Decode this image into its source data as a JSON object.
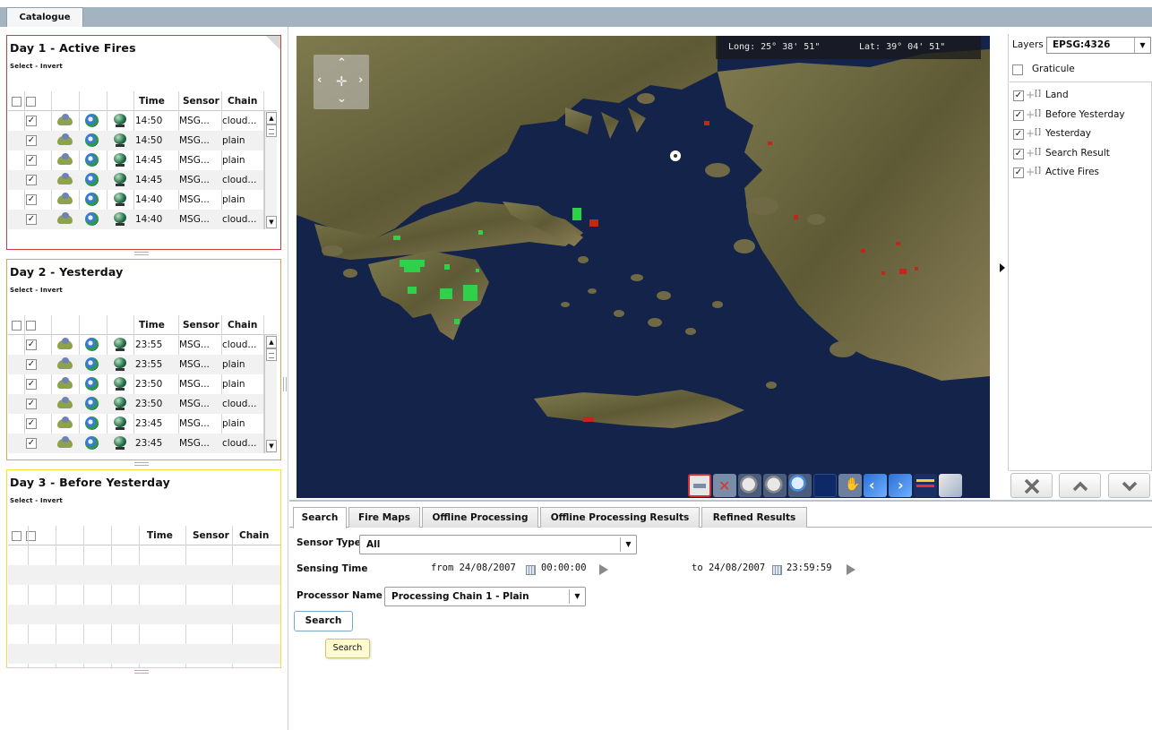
{
  "app": {
    "tab_label": "Catalogue"
  },
  "panels": [
    {
      "title": "Day 1 - Active Fires",
      "select_invert": "Select - Invert",
      "border_color": "#d23a3a",
      "columns": [
        "Time",
        "Sensor",
        "Chain"
      ],
      "rows": [
        {
          "checked": true,
          "time": "14:50",
          "sensor": "MSG...",
          "chain": "cloud..."
        },
        {
          "checked": true,
          "time": "14:50",
          "sensor": "MSG...",
          "chain": "plain"
        },
        {
          "checked": true,
          "time": "14:45",
          "sensor": "MSG...",
          "chain": "plain"
        },
        {
          "checked": true,
          "time": "14:45",
          "sensor": "MSG...",
          "chain": "cloud..."
        },
        {
          "checked": true,
          "time": "14:40",
          "sensor": "MSG...",
          "chain": "plain"
        },
        {
          "checked": true,
          "time": "14:40",
          "sensor": "MSG...",
          "chain": "cloud..."
        }
      ]
    },
    {
      "title": "Day 2 - Yesterday",
      "select_invert": "Select - Invert",
      "border_color": "#e6a23c",
      "columns": [
        "Time",
        "Sensor",
        "Chain"
      ],
      "rows": [
        {
          "checked": true,
          "time": "23:55",
          "sensor": "MSG...",
          "chain": "cloud..."
        },
        {
          "checked": true,
          "time": "23:55",
          "sensor": "MSG...",
          "chain": "plain"
        },
        {
          "checked": true,
          "time": "23:50",
          "sensor": "MSG...",
          "chain": "plain"
        },
        {
          "checked": true,
          "time": "23:50",
          "sensor": "MSG...",
          "chain": "cloud..."
        },
        {
          "checked": true,
          "time": "23:45",
          "sensor": "MSG...",
          "chain": "plain"
        },
        {
          "checked": true,
          "time": "23:45",
          "sensor": "MSG...",
          "chain": "cloud..."
        }
      ]
    },
    {
      "title": "Day 3 - Before Yesterday",
      "select_invert": "Select - Invert",
      "border_color": "#f2df3a",
      "columns": [
        "Time",
        "Sensor",
        "Chain"
      ],
      "rows": []
    }
  ],
  "map": {
    "longitude": "Long: 25° 38' 51\"",
    "latitude": "Lat: 39° 04' 51\""
  },
  "layers": {
    "label": "Layers",
    "crs": "EPSG:4326",
    "graticule": "Graticule",
    "items": [
      {
        "name": "Land",
        "checked": true
      },
      {
        "name": "Before Yesterday",
        "checked": true
      },
      {
        "name": "Yesterday",
        "checked": true
      },
      {
        "name": "Search Result",
        "checked": true
      },
      {
        "name": "Active Fires",
        "checked": true
      }
    ]
  },
  "bottom_tabs": [
    "Search",
    "Fire Maps",
    "Offline Processing",
    "Offline Processing Results",
    "Refined Results"
  ],
  "search_form": {
    "sensor_type_label": "Sensor Type",
    "sensor_type_value": "All",
    "sensing_time_label": "Sensing Time",
    "from_text": "from 24/08/2007",
    "from_time": "00:00:00",
    "to_text": "to 24/08/2007",
    "to_time": "23:59:59",
    "processor_label": "Processor Name",
    "processor_value": "Processing Chain 1 - Plain",
    "search_button": "Search",
    "tooltip": "Search"
  },
  "colors": {
    "fire_active": "#c0281e",
    "fire_green": "#2fd14a",
    "sea": "#14234a"
  }
}
